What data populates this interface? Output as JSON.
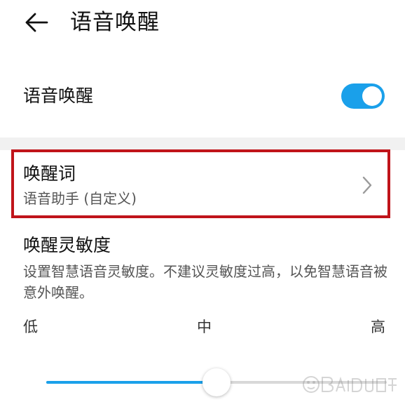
{
  "header": {
    "title": "语音唤醒",
    "back_icon": "arrow-left-icon"
  },
  "voice_wake": {
    "label": "语音唤醒",
    "enabled": true
  },
  "wake_word": {
    "title": "唤醒词",
    "value": "语音助手 (自定义)",
    "chevron_icon": "chevron-right-icon"
  },
  "sensitivity": {
    "title": "唤醒灵敏度",
    "description": "设置智慧语音灵敏度。不建议灵敏度过高，以免智慧语音被意外唤醒。",
    "tick_low": "低",
    "tick_mid": "中",
    "tick_high": "高",
    "level": 0.5
  },
  "watermark": {
    "text": "Baidu经验"
  },
  "colors": {
    "accent": "#1aa0ea",
    "highlight_border": "#c0141a",
    "section_gap": "#f1f1f1"
  }
}
